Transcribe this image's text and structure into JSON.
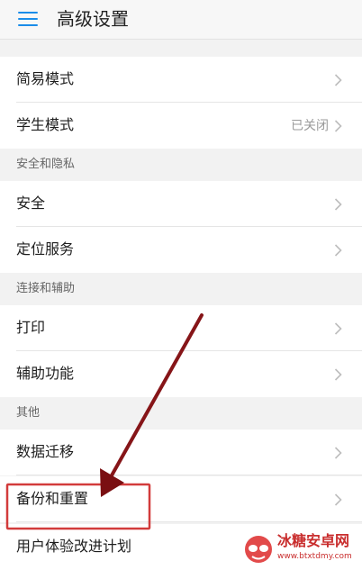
{
  "header": {
    "title": "高级设置",
    "menu_icon": "hamburger-menu-icon",
    "accent": "#1a8de9"
  },
  "rows": {
    "simple_mode": {
      "label": "简易模式"
    },
    "student_mode": {
      "label": "学生模式",
      "value": "已关闭"
    },
    "security": {
      "label": "安全"
    },
    "location": {
      "label": "定位服务"
    },
    "print": {
      "label": "打印"
    },
    "accessibility": {
      "label": "辅助功能"
    },
    "data_migration": {
      "label": "数据迁移"
    },
    "backup_reset": {
      "label": "备份和重置"
    },
    "user_experience": {
      "label": "用户体验改进计划"
    }
  },
  "sections": {
    "security_privacy": "安全和隐私",
    "connect_assist": "连接和辅助",
    "other": "其他"
  },
  "annotation": {
    "highlight_color": "#d23b3b",
    "arrow_color": "#7a0f12"
  },
  "watermark": {
    "text": "冰糖安卓网",
    "url": "www.btxtdmy.com"
  }
}
